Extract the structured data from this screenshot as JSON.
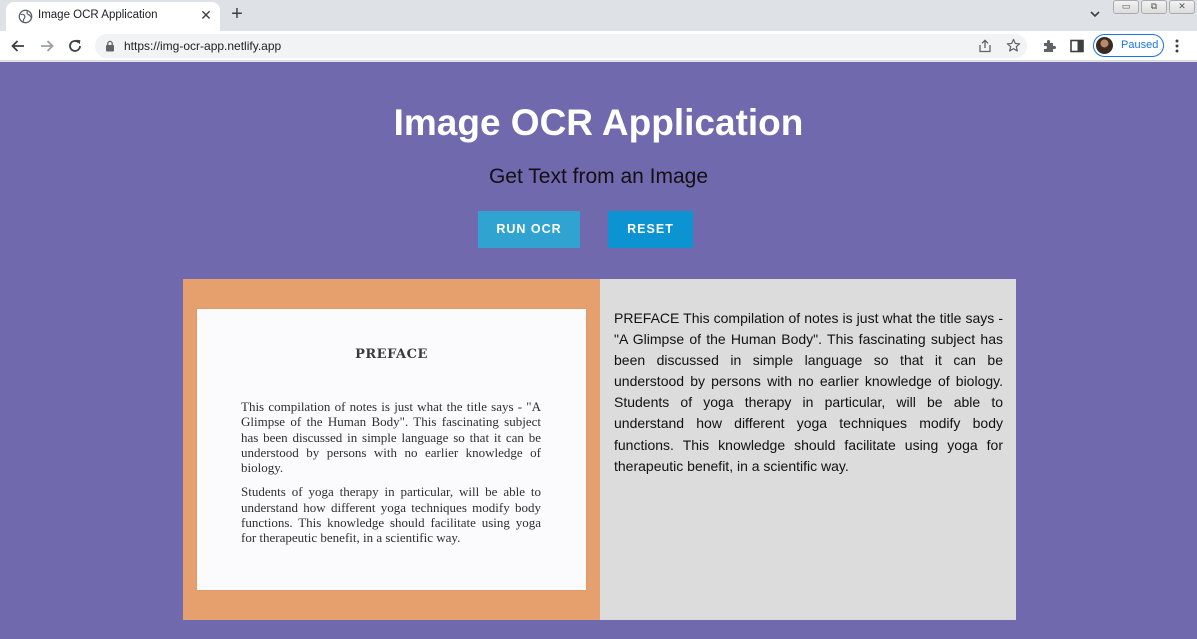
{
  "browser": {
    "tab_title": "Image OCR Application",
    "url": "https://img-ocr-app.netlify.app",
    "profile_status": "Paused",
    "icons": {
      "favicon": "globe-icon",
      "tab_close": "close-icon",
      "new_tab": "plus-icon",
      "back": "back-arrow-icon",
      "forward": "forward-arrow-icon",
      "reload": "reload-icon",
      "lock": "lock-icon",
      "share": "share-icon",
      "bookmark": "star-icon",
      "extensions": "puzzle-icon",
      "side_panel": "side-panel-icon",
      "menu": "kebab-menu-icon"
    }
  },
  "app": {
    "title": "Image OCR Application",
    "subtitle": "Get Text from an Image",
    "buttons": {
      "run_ocr": "RUN OCR",
      "reset": "RESET"
    },
    "image": {
      "heading": "PREFACE",
      "paragraph_1": "This compilation of notes is just what the title says - \"A Glimpse of the Human Body\". This fascinating subject has been discussed in simple language so that it can be understood by persons with no earlier knowledge of biology.",
      "paragraph_2": "Students of yoga therapy in particular, will be able to understand how different yoga techniques modify body functions. This knowledge should facilitate using yoga for therapeutic benefit, in a scientific way."
    },
    "ocr_result": "PREFACE This compilation of notes is just what the title says - \"A Glimpse of the Human Body\". This fascinating subject has been discussed in simple language so that it can be understood by persons with no earlier knowledge of biology. Students of yoga therapy in particular, will be able to understand how different yoga techniques modify body functions. This knowledge should facilitate using yoga for therapeutic benefit, in a scientific way."
  },
  "colors": {
    "page_background": "#7069ae",
    "run_button": "#31a3d0",
    "reset_button": "#0b93d2",
    "image_panel": "#e5a06e",
    "result_panel": "#dcdcdc",
    "profile_accent": "#1a73e8"
  }
}
